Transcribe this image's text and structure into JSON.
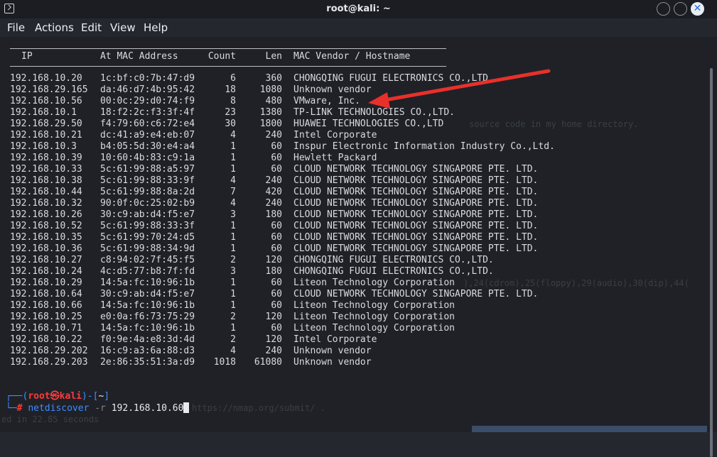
{
  "window": {
    "title": "root@kali: ~",
    "icon": "terminal-icon",
    "controls": {
      "minimize": "minimize-icon",
      "maximize": "maximize-icon",
      "close": "close-icon",
      "close_glyph": "✕"
    }
  },
  "menu": [
    "File",
    "Actions",
    "Edit",
    "View",
    "Help"
  ],
  "table": {
    "headers": {
      "ip": "IP",
      "mac": "At MAC Address",
      "count": "Count",
      "len": "Len",
      "vendor": "MAC Vendor / Hostname"
    },
    "rows": [
      {
        "ip": "192.168.10.20",
        "mac": "1c:bf:c0:7b:47:d9",
        "count": "6",
        "len": "360",
        "vendor": "CHONGQING FUGUI ELECTRONICS CO.,LTD."
      },
      {
        "ip": "192.168.29.165",
        "mac": "da:46:d7:4b:95:42",
        "count": "18",
        "len": "1080",
        "vendor": "Unknown vendor"
      },
      {
        "ip": "192.168.10.56",
        "mac": "00:0c:29:d0:74:f9",
        "count": "8",
        "len": "480",
        "vendor": "VMware, Inc."
      },
      {
        "ip": "192.168.10.1",
        "mac": "18:f2:2c:f3:3f:4f",
        "count": "23",
        "len": "1380",
        "vendor": "TP-LINK TECHNOLOGIES CO.,LTD."
      },
      {
        "ip": "192.168.29.50",
        "mac": "f4:79:60:c6:72:e4",
        "count": "30",
        "len": "1800",
        "vendor": "HUAWEI TECHNOLOGIES CO.,LTD"
      },
      {
        "ip": "192.168.10.21",
        "mac": "dc:41:a9:e4:eb:07",
        "count": "4",
        "len": "240",
        "vendor": "Intel Corporate"
      },
      {
        "ip": "192.168.10.3",
        "mac": "b4:05:5d:30:e4:a4",
        "count": "1",
        "len": "60",
        "vendor": "Inspur Electronic Information Industry Co.,Ltd."
      },
      {
        "ip": "192.168.10.39",
        "mac": "10:60:4b:83:c9:1a",
        "count": "1",
        "len": "60",
        "vendor": "Hewlett Packard"
      },
      {
        "ip": "192.168.10.33",
        "mac": "5c:61:99:88:a5:97",
        "count": "1",
        "len": "60",
        "vendor": "CLOUD NETWORK TECHNOLOGY SINGAPORE PTE. LTD."
      },
      {
        "ip": "192.168.10.38",
        "mac": "5c:61:99:88:33:9f",
        "count": "4",
        "len": "240",
        "vendor": "CLOUD NETWORK TECHNOLOGY SINGAPORE PTE. LTD."
      },
      {
        "ip": "192.168.10.44",
        "mac": "5c:61:99:88:8a:2d",
        "count": "7",
        "len": "420",
        "vendor": "CLOUD NETWORK TECHNOLOGY SINGAPORE PTE. LTD."
      },
      {
        "ip": "192.168.10.32",
        "mac": "90:0f:0c:25:02:b9",
        "count": "4",
        "len": "240",
        "vendor": "CLOUD NETWORK TECHNOLOGY SINGAPORE PTE. LTD."
      },
      {
        "ip": "192.168.10.26",
        "mac": "30:c9:ab:d4:f5:e7",
        "count": "3",
        "len": "180",
        "vendor": "CLOUD NETWORK TECHNOLOGY SINGAPORE PTE. LTD."
      },
      {
        "ip": "192.168.10.52",
        "mac": "5c:61:99:88:33:3f",
        "count": "1",
        "len": "60",
        "vendor": "CLOUD NETWORK TECHNOLOGY SINGAPORE PTE. LTD."
      },
      {
        "ip": "192.168.10.35",
        "mac": "5c:61:99:70:24:d5",
        "count": "1",
        "len": "60",
        "vendor": "CLOUD NETWORK TECHNOLOGY SINGAPORE PTE. LTD."
      },
      {
        "ip": "192.168.10.36",
        "mac": "5c:61:99:88:34:9d",
        "count": "1",
        "len": "60",
        "vendor": "CLOUD NETWORK TECHNOLOGY SINGAPORE PTE. LTD."
      },
      {
        "ip": "192.168.10.27",
        "mac": "c8:94:02:7f:45:f5",
        "count": "2",
        "len": "120",
        "vendor": "CHONGQING FUGUI ELECTRONICS CO.,LTD."
      },
      {
        "ip": "192.168.10.24",
        "mac": "4c:d5:77:b8:7f:fd",
        "count": "3",
        "len": "180",
        "vendor": "CHONGQING FUGUI ELECTRONICS CO.,LTD."
      },
      {
        "ip": "192.168.10.29",
        "mac": "14:5a:fc:10:96:1b",
        "count": "1",
        "len": "60",
        "vendor": "Liteon Technology Corporation"
      },
      {
        "ip": "192.168.10.64",
        "mac": "30:c9:ab:d4:f5:e7",
        "count": "1",
        "len": "60",
        "vendor": "CLOUD NETWORK TECHNOLOGY SINGAPORE PTE. LTD."
      },
      {
        "ip": "192.168.10.66",
        "mac": "14:5a:fc:10:96:1b",
        "count": "1",
        "len": "60",
        "vendor": "Liteon Technology Corporation"
      },
      {
        "ip": "192.168.10.25",
        "mac": "e0:0a:f6:73:75:29",
        "count": "2",
        "len": "120",
        "vendor": "Liteon Technology Corporation"
      },
      {
        "ip": "192.168.10.71",
        "mac": "14:5a:fc:10:96:1b",
        "count": "1",
        "len": "60",
        "vendor": "Liteon Technology Corporation"
      },
      {
        "ip": "192.168.10.22",
        "mac": "f0:9e:4a:e8:3d:4d",
        "count": "2",
        "len": "120",
        "vendor": "Intel Corporate"
      },
      {
        "ip": "192.168.29.202",
        "mac": "16:c9:a3:6a:88:d3",
        "count": "4",
        "len": "240",
        "vendor": "Unknown vendor"
      },
      {
        "ip": "192.168.29.203",
        "mac": "2e:86:35:51:3a:d9",
        "count": "1018",
        "len": "61080",
        "vendor": "Unknown vendor"
      }
    ]
  },
  "prompt": {
    "open": "┌──(",
    "user": "root",
    "at_glyph": "㉿",
    "host": "kali",
    "mid": ")-[",
    "dir": "~",
    "close": "]",
    "line2_prefix": "└─",
    "hash": "#",
    "command": "netdiscover",
    "flag": "-r",
    "argument": "192.168.10.60"
  },
  "ghost_text": {
    "source": "source code in my home directory.",
    "groups": "),24(cdrom),25(floppy),29(audio),30(dip),44(",
    "nmap": "https://nmap.org/submit/ .",
    "seconds": "ed in 22.85 seconds"
  },
  "annotation": {
    "arrow_color": "#e8302a",
    "target_row": "VMware, Inc."
  }
}
